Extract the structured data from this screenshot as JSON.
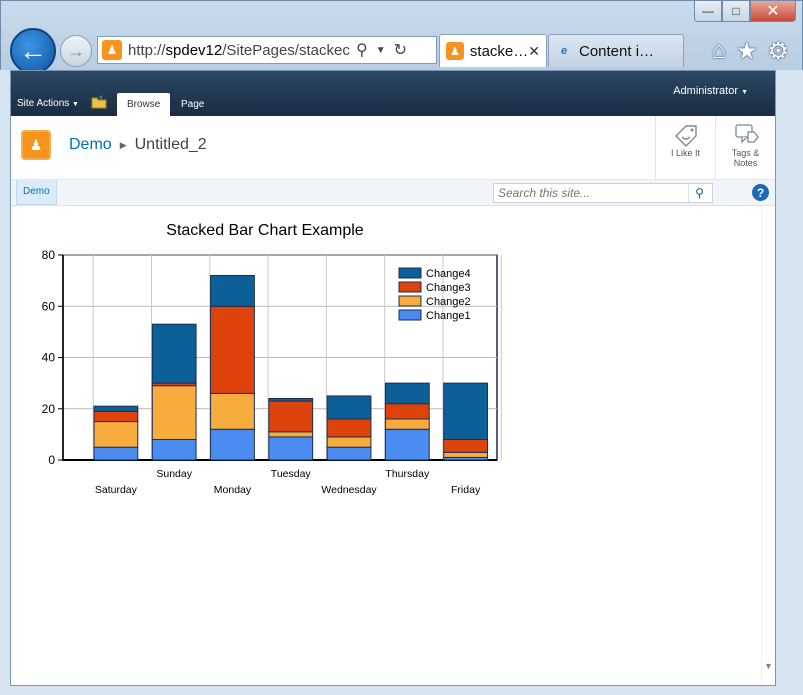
{
  "browser": {
    "url_scheme": "http://",
    "url_host": "spdev12",
    "url_path": "/SitePages/stackec",
    "tabs": [
      {
        "label": "stacke…",
        "active": true
      },
      {
        "label": "Content i…",
        "active": false
      }
    ],
    "window_buttons": {
      "minimize": "—",
      "maximize": "□",
      "close": "✕"
    }
  },
  "ribbon": {
    "site_actions": "Site Actions",
    "tabs": [
      "Browse",
      "Page"
    ],
    "user": "Administrator"
  },
  "titlearea": {
    "breadcrumb": [
      "Demo",
      "Untitled_2"
    ],
    "i_like_it": "I Like It",
    "tags_notes_line1": "Tags &",
    "tags_notes_line2": "Notes"
  },
  "topnav": {
    "demo_tab": "Demo",
    "search_placeholder": "Search this site..."
  },
  "chart_data": {
    "type": "bar",
    "title": "Stacked Bar Chart Example",
    "categories": [
      "Saturday",
      "Sunday",
      "Monday",
      "Tuesday",
      "Wednesday",
      "Thursday",
      "Friday"
    ],
    "ylim": [
      0,
      80
    ],
    "yticks": [
      0,
      20,
      40,
      60,
      80
    ],
    "grid": true,
    "legend_position": "top-right",
    "series": [
      {
        "name": "Change1",
        "color": "#4a8cf0",
        "values": [
          5,
          8,
          12,
          9,
          5,
          12,
          1
        ]
      },
      {
        "name": "Change2",
        "color": "#f8ac3e",
        "values": [
          10,
          21,
          14,
          2,
          4,
          4,
          2
        ]
      },
      {
        "name": "Change3",
        "color": "#de430c",
        "values": [
          4,
          1,
          34,
          12,
          7,
          6,
          5
        ]
      },
      {
        "name": "Change4",
        "color": "#0d5f97",
        "values": [
          2,
          23,
          12,
          1,
          9,
          8,
          22
        ]
      }
    ]
  }
}
